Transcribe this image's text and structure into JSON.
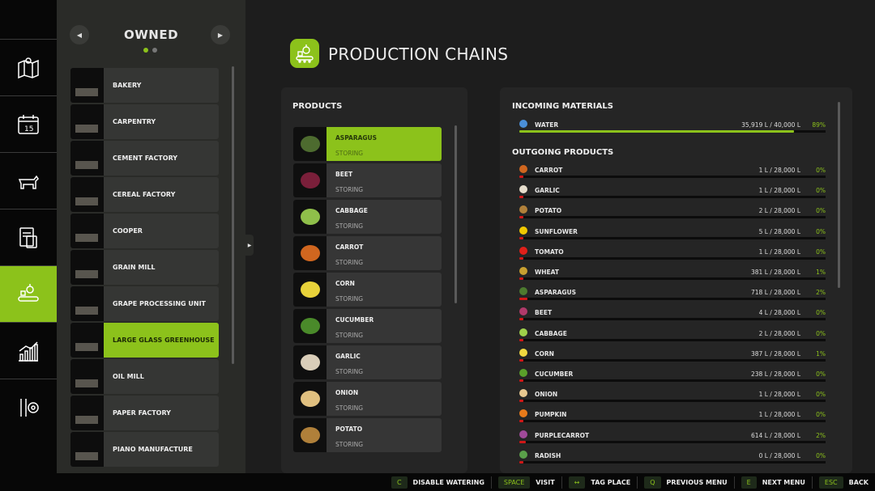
{
  "sidebar": {
    "items": [
      {
        "icon": "map-icon"
      },
      {
        "icon": "calendar-icon",
        "label": "15"
      },
      {
        "icon": "animals-icon"
      },
      {
        "icon": "contracts-icon"
      },
      {
        "icon": "production-icon",
        "active": true
      },
      {
        "icon": "statistics-icon"
      },
      {
        "icon": "settings-icon"
      }
    ]
  },
  "owned": {
    "title": "OWNED",
    "page": 1,
    "pages": 2,
    "items": [
      {
        "label": "BAKERY"
      },
      {
        "label": "CARPENTRY"
      },
      {
        "label": "CEMENT FACTORY"
      },
      {
        "label": "CEREAL FACTORY"
      },
      {
        "label": "COOPER"
      },
      {
        "label": "GRAIN MILL"
      },
      {
        "label": "GRAPE PROCESSING UNIT"
      },
      {
        "label": "LARGE GLASS GREENHOUSE",
        "selected": true
      },
      {
        "label": "OIL MILL"
      },
      {
        "label": "PAPER FACTORY"
      },
      {
        "label": "PIANO MANUFACTURE"
      }
    ]
  },
  "header": {
    "title": "PRODUCTION CHAINS",
    "icon": "production-icon"
  },
  "products": {
    "title": "PRODUCTS",
    "items": [
      {
        "name": "ASPARAGUS",
        "status": "STORING",
        "selected": true,
        "color": "#4d6b2f"
      },
      {
        "name": "BEET",
        "status": "STORING",
        "color": "#7a1f3a"
      },
      {
        "name": "CABBAGE",
        "status": "STORING",
        "color": "#8fbf4a"
      },
      {
        "name": "CARROT",
        "status": "STORING",
        "color": "#d0661f"
      },
      {
        "name": "CORN",
        "status": "STORING",
        "color": "#e8d23a"
      },
      {
        "name": "CUCUMBER",
        "status": "STORING",
        "color": "#4a8a2a"
      },
      {
        "name": "GARLIC",
        "status": "STORING",
        "color": "#d9cdb8"
      },
      {
        "name": "ONION",
        "status": "STORING",
        "color": "#e0c080"
      },
      {
        "name": "POTATO",
        "status": "STORING",
        "color": "#b0803a"
      }
    ]
  },
  "incoming": {
    "title": "INCOMING MATERIALS",
    "items": [
      {
        "name": "WATER",
        "amount": "35,919 L / 40,000 L",
        "percent": "89%",
        "fill": 89.8,
        "color": "#4a8fd8"
      }
    ]
  },
  "outgoing": {
    "title": "OUTGOING PRODUCTS",
    "items": [
      {
        "name": "CARROT",
        "amount": "1 L / 28,000 L",
        "percent": "0%",
        "fill": 0,
        "color": "#d0661f"
      },
      {
        "name": "GARLIC",
        "amount": "1 L / 28,000 L",
        "percent": "0%",
        "fill": 0,
        "color": "#e6ddcc"
      },
      {
        "name": "POTATO",
        "amount": "2 L / 28,000 L",
        "percent": "0%",
        "fill": 0,
        "color": "#b0803a"
      },
      {
        "name": "SUNFLOWER",
        "amount": "5 L / 28,000 L",
        "percent": "0%",
        "fill": 0,
        "color": "#f0c800"
      },
      {
        "name": "TOMATO",
        "amount": "1 L / 28,000 L",
        "percent": "0%",
        "fill": 0,
        "color": "#e0201a"
      },
      {
        "name": "WHEAT",
        "amount": "381 L / 28,000 L",
        "percent": "1%",
        "fill": 1.4,
        "color": "#c8a030"
      },
      {
        "name": "ASPARAGUS",
        "amount": "718 L / 28,000 L",
        "percent": "2%",
        "fill": 2.6,
        "color": "#4d7a2f"
      },
      {
        "name": "BEET",
        "amount": "4 L / 28,000 L",
        "percent": "0%",
        "fill": 0,
        "color": "#b03a6a"
      },
      {
        "name": "CABBAGE",
        "amount": "2 L / 28,000 L",
        "percent": "0%",
        "fill": 0,
        "color": "#9fd04a"
      },
      {
        "name": "CORN",
        "amount": "387 L / 28,000 L",
        "percent": "1%",
        "fill": 1.4,
        "color": "#f0d840"
      },
      {
        "name": "CUCUMBER",
        "amount": "238 L / 28,000 L",
        "percent": "0%",
        "fill": 0.8,
        "color": "#5aa02a"
      },
      {
        "name": "ONION",
        "amount": "1 L / 28,000 L",
        "percent": "0%",
        "fill": 0,
        "color": "#e8c890"
      },
      {
        "name": "PUMPKIN",
        "amount": "1 L / 28,000 L",
        "percent": "0%",
        "fill": 0,
        "color": "#e87a1a"
      },
      {
        "name": "PURPLECARROT",
        "amount": "614 L / 28,000 L",
        "percent": "2%",
        "fill": 2.2,
        "color": "#a04a9a"
      },
      {
        "name": "RADISH",
        "amount": "0 L / 28,000 L",
        "percent": "0%",
        "fill": 0,
        "color": "#5aa04a"
      }
    ]
  },
  "hints": [
    {
      "key": "C",
      "label": "DISABLE WATERING"
    },
    {
      "key": "SPACE",
      "label": "VISIT"
    },
    {
      "key": "↔",
      "label": "TAG PLACE"
    },
    {
      "key": "Q",
      "label": "PREVIOUS MENU"
    },
    {
      "key": "E",
      "label": "NEXT MENU"
    },
    {
      "key": "ESC",
      "label": "BACK"
    }
  ],
  "colors": {
    "accent": "#8cc21b",
    "low_fill": "#d01818"
  }
}
